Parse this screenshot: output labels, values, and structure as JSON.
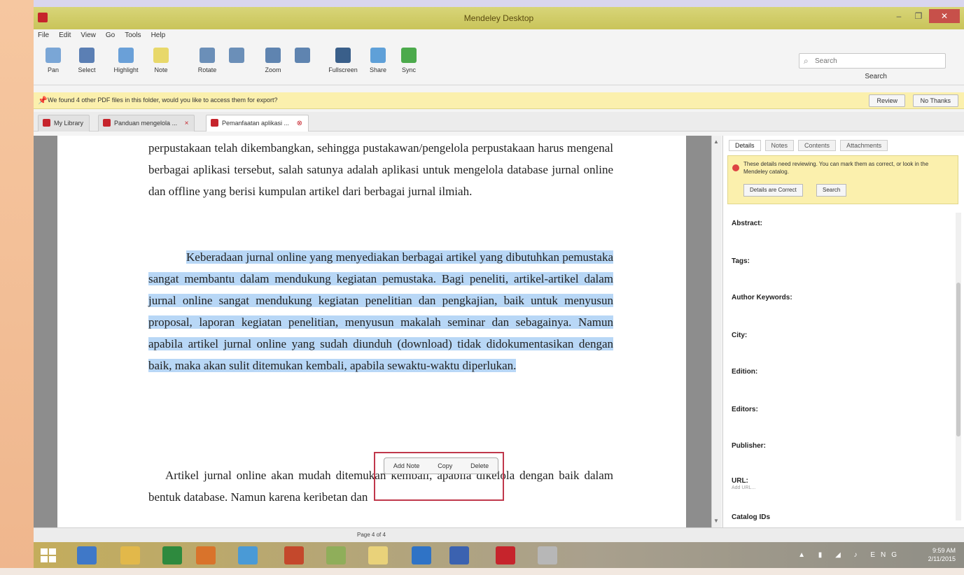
{
  "window": {
    "title": "Mendeley Desktop",
    "min": "–",
    "max": "❐",
    "close": "✕"
  },
  "menu": [
    "File",
    "Edit",
    "View",
    "Go",
    "Tools",
    "Help"
  ],
  "toolbar": {
    "buttons": [
      {
        "label": "Pan",
        "color": "#7aa6d6"
      },
      {
        "label": "Select",
        "color": "#5b7fb4"
      },
      {
        "label": "Highlight",
        "color": "#6aa0d8"
      },
      {
        "label": "Note",
        "color": "#e8d86a"
      },
      {
        "label": "Rotate",
        "color": "#6b8fb8"
      },
      {
        "label": "",
        "color": "#6b8fb8"
      },
      {
        "label": "Zoom",
        "color": "#5f84b0"
      },
      {
        "label": "",
        "color": "#5f84b0"
      },
      {
        "label": "Fullscreen",
        "color": "#3a5f8a"
      },
      {
        "label": "Share",
        "color": "#5fa0d8"
      },
      {
        "label": "Sync",
        "color": "#4caa4c"
      }
    ],
    "search_placeholder": "Search",
    "search_label": "Search"
  },
  "infobar": {
    "message": "We found 4 other PDF files in this folder, would you like to access them for export?",
    "buttons": [
      "Review",
      "No Thanks"
    ]
  },
  "tabs": [
    {
      "label": "My Library",
      "color": "#c6242c"
    },
    {
      "label": "Panduan mengelola ...",
      "color": "#c6242c"
    },
    {
      "label": "Pemanfaatan aplikasi ...",
      "color": "#c6242c"
    }
  ],
  "document": {
    "para1": "perpustakaan telah dikembangkan, sehingga pustakawan/pengelola perpustakaan harus mengenal berbagai aplikasi tersebut, salah satunya adalah aplikasi untuk mengelola database jurnal online dan offline yang berisi kumpulan artikel dari berbagai jurnal ilmiah.",
    "para2": "Keberadaan jurnal online yang menyediakan berbagai artikel yang dibutuhkan pemustaka sangat membantu dalam mendukung kegiatan pemustaka. Bagi peneliti, artikel-artikel dalam jurnal online sangat mendukung kegiatan penelitian dan pengkajian, baik untuk menyusun proposal, laporan kegiatan penelitian, menyusun makalah seminar dan sebagainya. Namun apabila artikel jurnal online yang sudah diunduh (download) tidak didokumentasikan dengan baik, maka akan sulit ditemukan kembali, apabila sewaktu-waktu diperlukan.",
    "para3": "Artikel jurnal online akan mudah ditemukan kembali, apabila dikelola dengan baik dalam bentuk database. Namun karena keribetan dan",
    "mini_toolbar": [
      "Add Note",
      "Copy",
      "Delete"
    ]
  },
  "sidebar": {
    "tabs": [
      "Details",
      "Notes",
      "Contents",
      "Attachments"
    ],
    "notice": "These details need reviewing. You can mark them as correct, or look in the Mendeley catalog.",
    "notice_buttons": [
      "Details are Correct",
      "Search"
    ],
    "fields": [
      "Abstract:",
      "Tags:",
      "Author Keywords:",
      "City:",
      "Edition:",
      "Editors:",
      "Publisher:",
      "URL:",
      "Catalog IDs"
    ],
    "url_sub": "Add URL..."
  },
  "status": {
    "page": "Page 4 of 4"
  },
  "taskbar": {
    "icons": [
      {
        "name": "ie",
        "color": "#3f78c8"
      },
      {
        "name": "explorer",
        "color": "#e2b84a"
      },
      {
        "name": "excel",
        "color": "#2e8a3e"
      },
      {
        "name": "firefox",
        "color": "#d9732b"
      },
      {
        "name": "chrome",
        "color": "#4a9ad6"
      },
      {
        "name": "app",
        "color": "#c4482c"
      },
      {
        "name": "paint",
        "color": "#8fae5a"
      },
      {
        "name": "folder",
        "color": "#e9d27a"
      },
      {
        "name": "shield",
        "color": "#2f73c6"
      },
      {
        "name": "word",
        "color": "#3b62b0"
      },
      {
        "name": "mendeley",
        "color": "#c6242c"
      },
      {
        "name": "misc",
        "color": "#b7b7b7"
      }
    ],
    "lang": "ENG",
    "time": "9:59 AM",
    "date": "2/11/2015"
  }
}
